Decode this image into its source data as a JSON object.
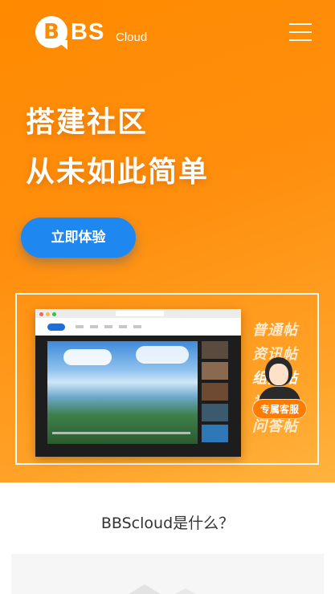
{
  "brand": {
    "logo_letter": "B",
    "logo_bs": "BS",
    "logo_cloud": "Cloud",
    "accent": "#ff8a00",
    "cta_color": "#1e87f0"
  },
  "header": {
    "menu_icon": "hamburger-menu-icon"
  },
  "hero": {
    "headline_line1": "搭建社区",
    "headline_line2": "从未如此简单",
    "cta_label": "立即体验"
  },
  "showcase": {
    "post_types": [
      "普通帖",
      "资讯帖",
      "组图帖",
      "视频帖",
      "问答帖"
    ],
    "support_label": "专属客服"
  },
  "intro": {
    "title": "BBScloud是什么？"
  }
}
